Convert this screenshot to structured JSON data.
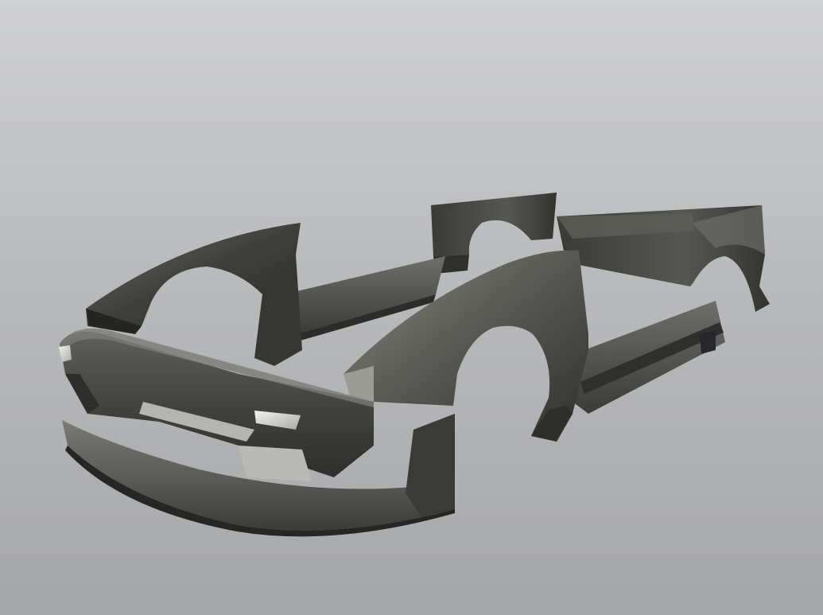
{
  "scene": {
    "subject": "car-body-kit-3d-render",
    "background_top": "#cfd0d2",
    "background_bottom": "#a6a7a9",
    "panel_dark": "#2e2f2c",
    "panel_mid": "#4d4e4a",
    "panel_light": "#8a8b84",
    "lens_color": "#d9dad6",
    "parts": [
      {
        "key": "rear-left-fender",
        "label": ""
      },
      {
        "key": "rear-right-fender",
        "label": ""
      },
      {
        "key": "left-side-skirt",
        "label": ""
      },
      {
        "key": "right-side-skirt",
        "label": ""
      },
      {
        "key": "front-left-fender",
        "label": ""
      },
      {
        "key": "front-right-fender",
        "label": ""
      },
      {
        "key": "front-bumper",
        "label": ""
      }
    ]
  }
}
